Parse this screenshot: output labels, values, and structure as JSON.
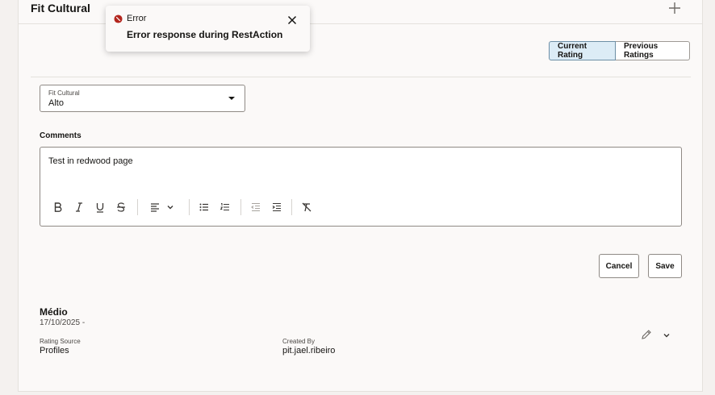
{
  "header": {
    "title": "Fit Cultural"
  },
  "ratings_toggle": {
    "current": "Current Rating",
    "previous": "Previous Ratings",
    "selected": "Current Rating"
  },
  "fit_select": {
    "label": "Fit Cultural",
    "value": "Alto"
  },
  "comments": {
    "label": "Comments",
    "text": "Test in redwood page",
    "toolbar_icons": [
      "bold-icon",
      "italic-icon",
      "underline-icon",
      "strikethrough-icon",
      "align-left-icon",
      "chevron-down-icon",
      "bulleted-list-icon",
      "numbered-list-icon",
      "outdent-icon",
      "indent-icon",
      "clear-formatting-icon"
    ]
  },
  "actions": {
    "cancel": "Cancel",
    "save": "Save"
  },
  "record": {
    "title": "Médio",
    "date": "17/10/2025 -",
    "rating_source_label": "Rating Source",
    "rating_source": "Profiles",
    "created_by_label": "Created By",
    "created_by": "pit.jael.ribeiro"
  },
  "toast": {
    "title": "Error",
    "message": "Error response during RestAction",
    "color": "#b3261e"
  },
  "colors": {
    "accent": "#dcecf6",
    "panel": "#fbf9f8",
    "background": "#f4f1ef"
  }
}
